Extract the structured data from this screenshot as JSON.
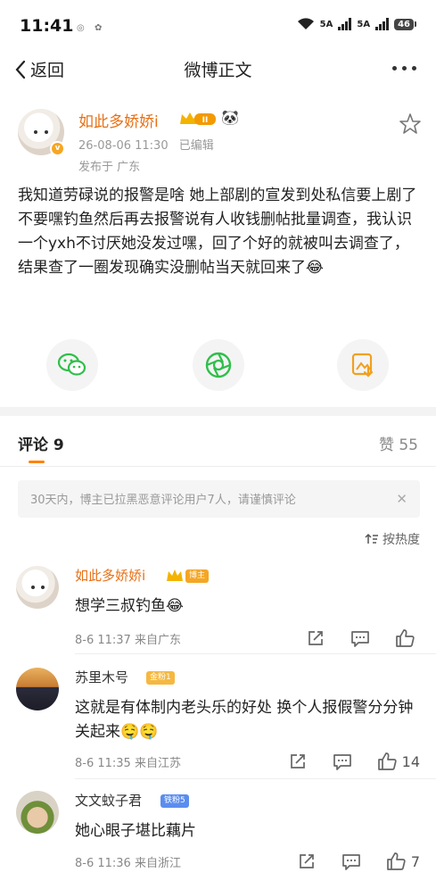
{
  "status_bar": {
    "time": "11:41",
    "network_1": "5A",
    "network_2": "5A",
    "battery": "46"
  },
  "nav": {
    "back_label": "返回",
    "title": "微博正文"
  },
  "post": {
    "author": "如此多娇娇i",
    "level_badge": "II",
    "date": "26-08-06 11:30",
    "edited": "已编辑",
    "location": "发布于 广东",
    "text": "我知道劳碌说的报警是啥 她上部剧的宣发到处私信要上剧了不要嘿钓鱼然后再去报警说有人收钱删帖批量调查，我认识一个yxh不讨厌她没发过嘿，回了个好的就被叫去调查了，结果查了一圈发现确实没删帖当天就回来了😂"
  },
  "comments_section": {
    "label": "评论 9",
    "likes_label": "赞 55",
    "notice": "30天内，博主已拉黑恶意评论用户7人，请谨慎评论",
    "sort_label": "按热度"
  },
  "comments": [
    {
      "name": "如此多娇娇i",
      "tag": "博主",
      "text": "想学三叔钓鱼😂",
      "time": "8-6 11:37 来自广东",
      "like_count": ""
    },
    {
      "name": "苏里木号",
      "tag": "金粉1",
      "text": "这就是有体制内老头乐的好处 换个人报假警分分钟关起来🤤🤤",
      "time": "8-6 11:35 来自江苏",
      "like_count": "14"
    },
    {
      "name": "文文蚊子君",
      "tag": "铁粉5",
      "text": "她心眼子堪比藕片",
      "time": "8-6 11:36 来自浙江",
      "like_count": "7"
    }
  ],
  "colors": {
    "orange_name": "#e86f13",
    "accent": "#ff8200",
    "share_green": "#2fbf4a",
    "share_orange": "#f0a020"
  }
}
